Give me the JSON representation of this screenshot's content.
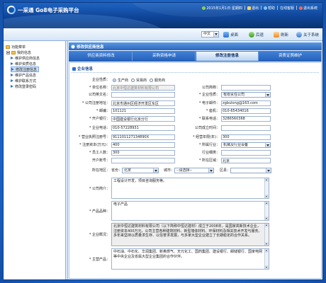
{
  "colors": {
    "outer_bg": "#1c66c9",
    "header_bg": "#0f4598",
    "accent": "#2a66bd",
    "tab_active_bg": "#b9d3f2",
    "selected_menu_bg": "#cfe2fa"
  },
  "header": {
    "logo_icon": "swirl-logo-icon",
    "logo_text": "一采通 Go8电子采购平台",
    "date_text": "2015年1月1日 星期四",
    "logout": "退出",
    "help": "帮助",
    "online_service": "在线客服",
    "exit": "退出系统"
  },
  "toolbar": {
    "language": "中文",
    "buttons": [
      {
        "label": "桌面",
        "icon": "desktop-icon"
      },
      {
        "label": "后退",
        "icon": "back-icon"
      },
      {
        "label": "刷新",
        "icon": "refresh-icon"
      },
      {
        "label": "关于系统",
        "icon": "info-icon"
      }
    ]
  },
  "sidebar": {
    "title": "功能菜单",
    "group": "我的信息",
    "items": [
      {
        "label": "维护供应商信息"
      },
      {
        "label": "维护资质信息"
      },
      {
        "label": "修改注册信息",
        "selected": true
      },
      {
        "label": "维护产品信息"
      },
      {
        "label": "维护联系方式"
      },
      {
        "label": "修改登录密码"
      }
    ]
  },
  "panel": {
    "title": "修改供应商信息"
  },
  "tabs": [
    {
      "label": "供应商资料修改"
    },
    {
      "label": "采购资格申请"
    },
    {
      "label": "修改注册信息",
      "active": true
    },
    {
      "label": "资质证照维护"
    }
  ],
  "form": {
    "section_title": "企业信息",
    "enterprise_type": {
      "label": "企业性质：",
      "options": [
        "生产商",
        "贸易商",
        "服务商"
      ],
      "selected_index": 0
    },
    "rows": [
      {
        "left": {
          "label": "* 单位名称：",
          "value": "北京中恒达建筑材料有限公司"
        },
        "right": {
          "label": "公司简称：",
          "value": ""
        }
      },
      {
        "left": {
          "label": "公司英文名：",
          "value": ""
        },
        "right": {
          "label": "* 企业性质：",
          "value": "有限责任公司"
        }
      },
      {
        "left": {
          "label": "* 公司注册地址：",
          "value": "北京市通州区经济开发区东区"
        },
        "right": {
          "label": "* 电子邮件：",
          "value": "zgbulong@163.com"
        }
      },
      {
        "left": {
          "label": "* 邮编：",
          "value": "101121"
        },
        "right": {
          "label": "* 座机：",
          "value": "010-65434016"
        }
      },
      {
        "left": {
          "label": "* 开户银行：",
          "value": "中国建设银行北京分行"
        },
        "right": {
          "label": "* 联系电话：",
          "value": "3286560368"
        }
      },
      {
        "left": {
          "label": "* 企业电话：",
          "value": "010-57228931"
        },
        "right": {
          "label": "公司成立时间：",
          "value": ""
        }
      },
      {
        "left": {
          "label": "* 营业执照注册号：",
          "value": "911101127134890X"
        },
        "right": {
          "label": "* 经营年限(年)：",
          "value": "300"
        }
      },
      {
        "left": {
          "label": "* 注册资本(万元)：",
          "value": "400"
        },
        "right": {
          "label": "* 所属行业：",
          "value": "机械及行业设备"
        }
      },
      {
        "left": {
          "label": "* 员工人数：",
          "value": "300"
        },
        "right": {
          "label": "行业细类：",
          "value": ""
        }
      },
      {
        "left": {
          "label": "开户账号：",
          "value": ""
        },
        "right": {
          "label": "* 所在区域：",
          "value": "北京"
        }
      }
    ],
    "region": {
      "label": "所在地区：",
      "province_label": "省份：",
      "province": "北京",
      "city_label": "城市：",
      "city": "--请选择--",
      "district_label": "区县：",
      "district": ""
    },
    "intro": {
      "label": "* 公司简介：",
      "value": "工程设计开发，项目咨询服务等。"
    },
    "products": {
      "label": "* 产品品种：",
      "value": "电子产品"
    },
    "overview": {
      "label": "* 企业概况：",
      "value": "北京中恒达建筑材料有限公司（以下简称中恒达建材）成立于2008年，是国家高新技术企业，注册资本400万元，公司主营各种建筑材料、新型墙体材料、环保材料及相关技术开发与服务。多年来坚持以质量求生存、以信誉求发展，与多家大型企业建立了长期稳定的合作关系。"
    },
    "main_products": {
      "label": "* 主营产品：",
      "value": "中石油、中石化、华润集团、新奥燃气、天元化工、国药集团、建设银行、邮储银行、国家电网等中央企业及省属大型企业集团的合作伙伴。"
    }
  }
}
